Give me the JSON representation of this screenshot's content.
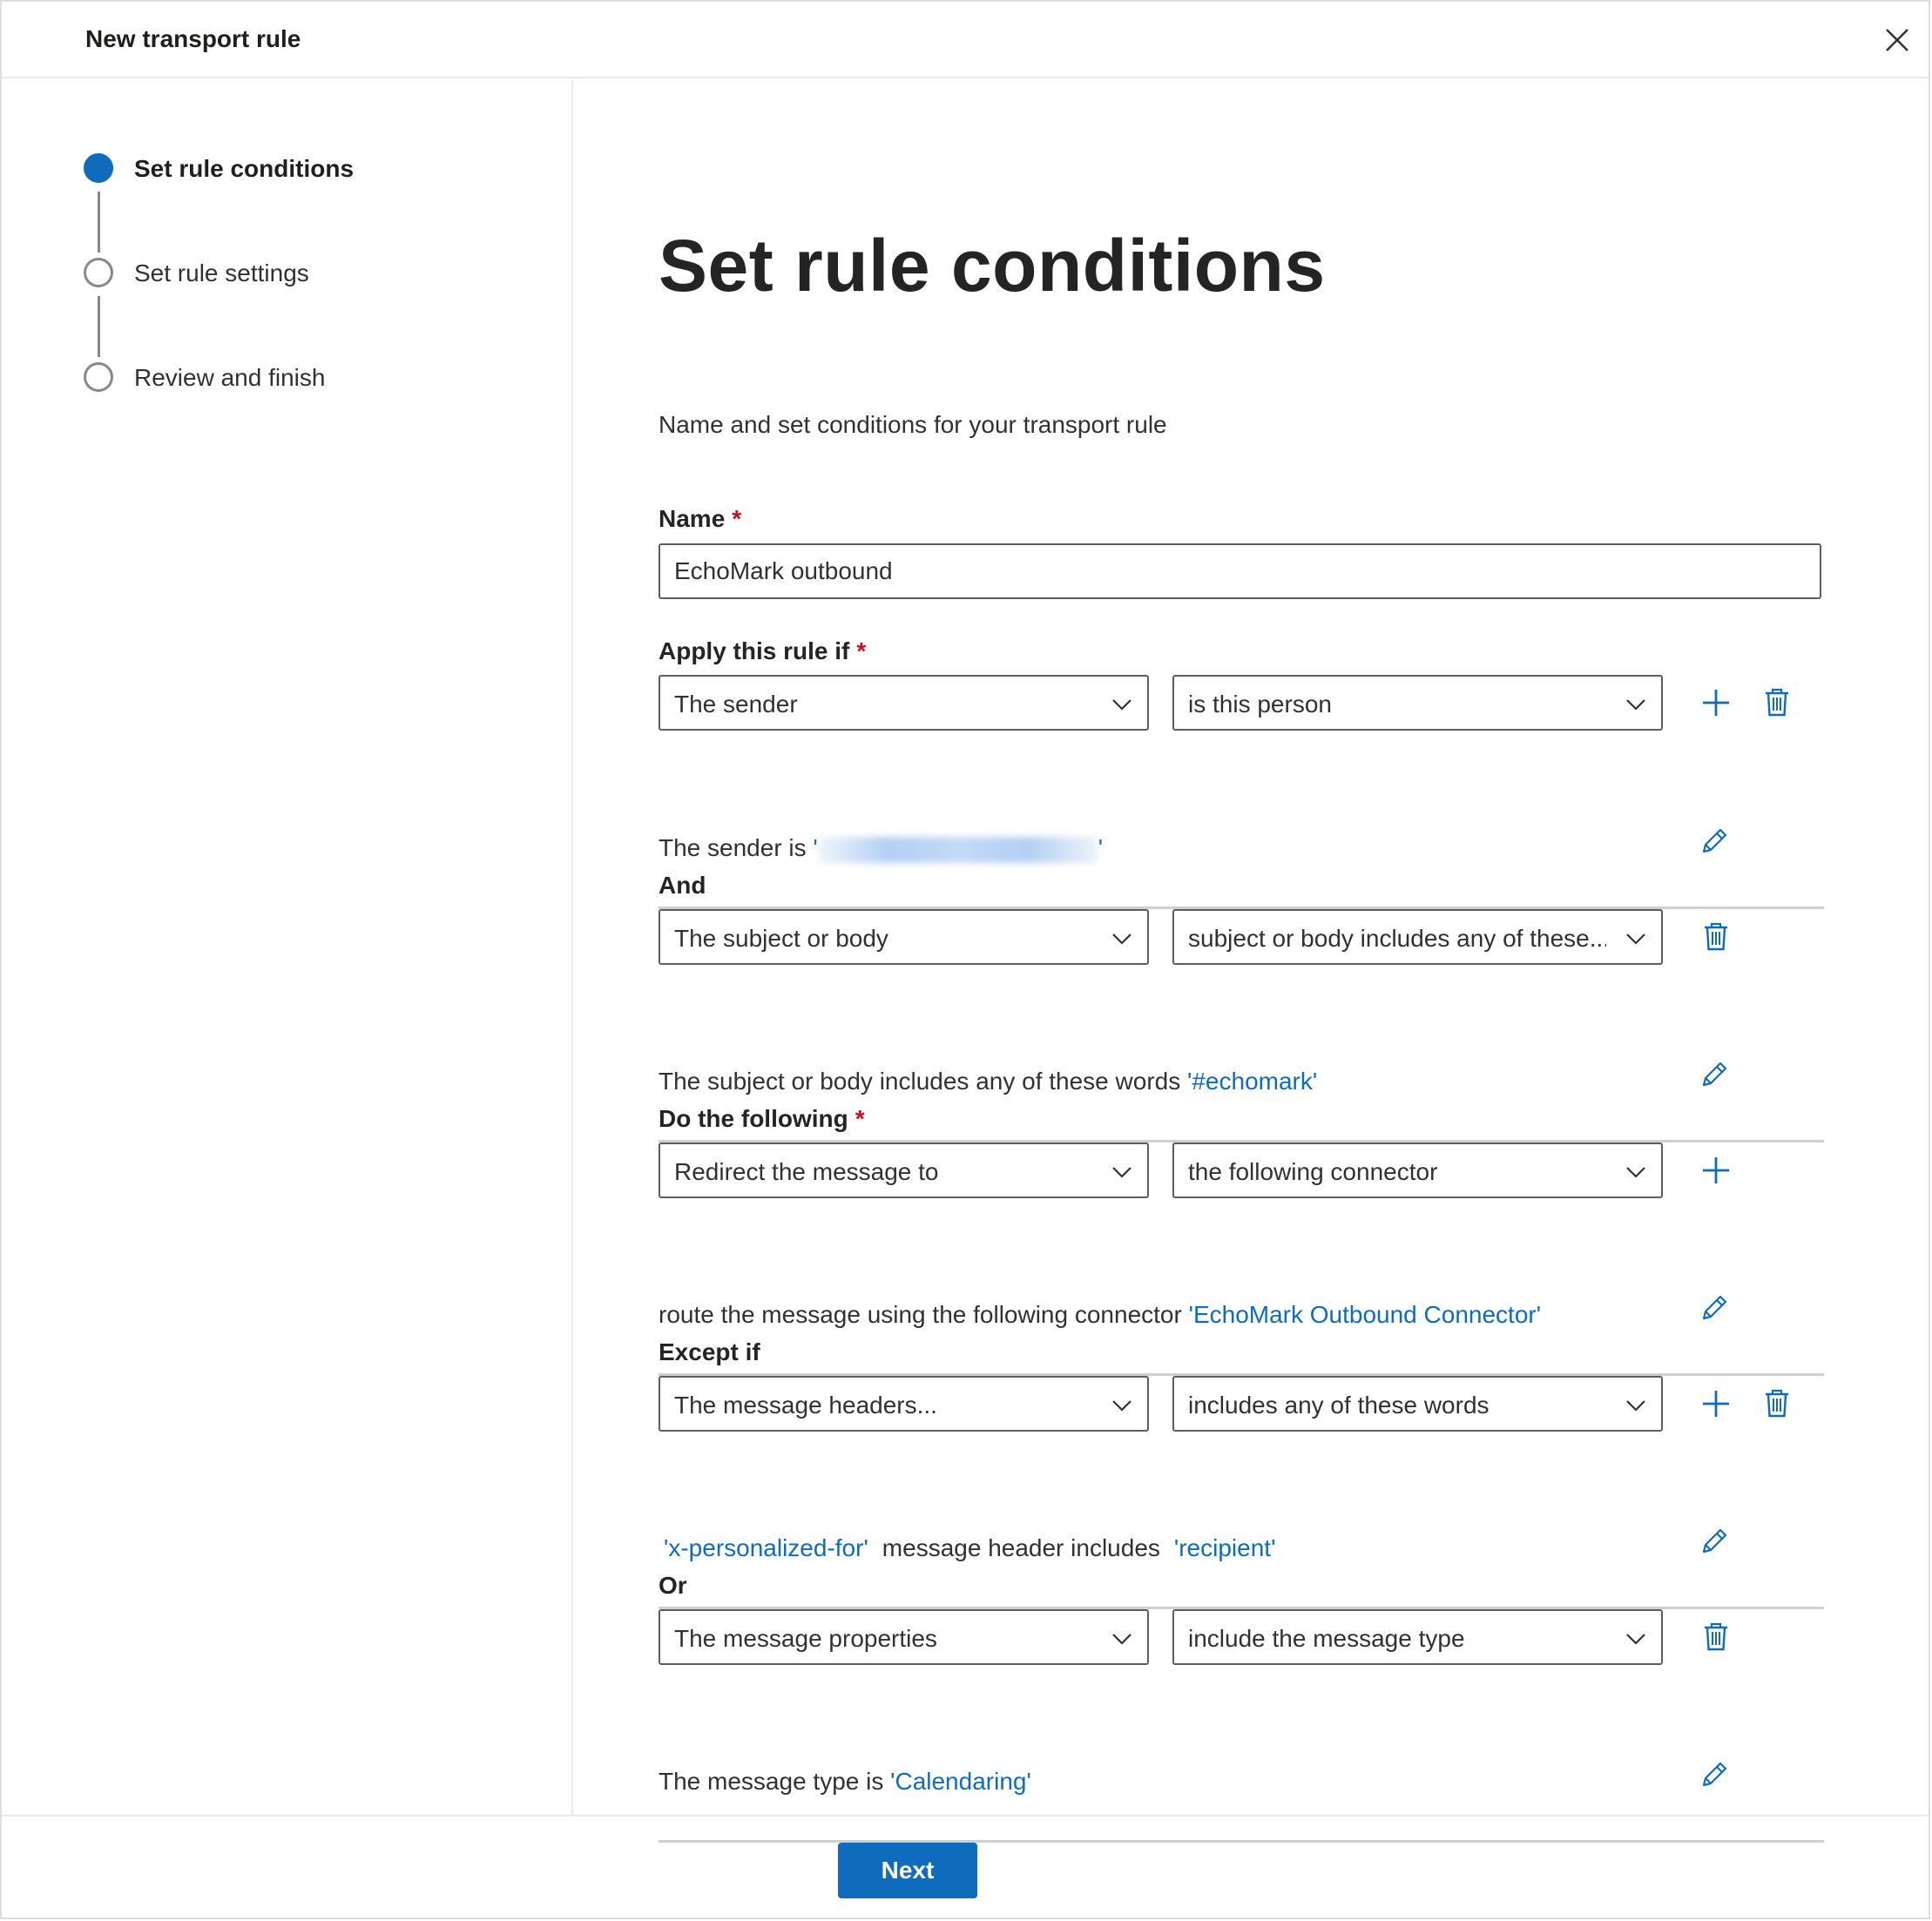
{
  "header": {
    "title": "New transport rule",
    "close_icon": "close-icon"
  },
  "nav": {
    "steps": [
      {
        "label": "Set rule conditions",
        "state": "active"
      },
      {
        "label": "Set rule settings",
        "state": "pending"
      },
      {
        "label": "Review and finish",
        "state": "pending"
      }
    ]
  },
  "main": {
    "title": "Set rule conditions",
    "subtitle": "Name and set conditions for your transport rule",
    "name": {
      "label": "Name",
      "required_mark": "*",
      "value": "EchoMark outbound"
    },
    "sections": [
      {
        "label": "Apply this rule if",
        "required_mark": "*",
        "left": "The sender",
        "right": "is this person",
        "desc_prefix": "The sender is ",
        "desc_link": "'",
        "desc_suffix": "'",
        "has_add": true,
        "has_delete": true
      },
      {
        "label": "And",
        "required_mark": "",
        "left": "The subject or body",
        "right": "subject or body includes any of these...",
        "desc_prefix": "The subject or body includes any of these words ",
        "desc_link": "'#echomark'",
        "has_add": false,
        "has_delete": true
      },
      {
        "label": "Do the following",
        "required_mark": "*",
        "left": "Redirect the message to",
        "right": "the following connector",
        "desc_prefix": "route the message using the following connector ",
        "desc_link": "'EchoMark Outbound Connector'",
        "has_add": true,
        "has_delete": false
      },
      {
        "label": "Except if",
        "required_mark": "",
        "left": "The message headers...",
        "right": "includes any of these words",
        "desc_link_1": "'x-personalized-for'",
        "desc_middle": "message header includes",
        "desc_link_2": "'recipient'",
        "has_add": true,
        "has_delete": true
      },
      {
        "label": "Or",
        "required_mark": "",
        "left": "The message properties",
        "right": "include the message type",
        "desc_prefix": "The message type is ",
        "desc_link": "'Calendaring'",
        "has_add": false,
        "has_delete": true
      }
    ]
  },
  "footer": {
    "next_label": "Next"
  },
  "colors": {
    "accent": "#0f6cbd",
    "required": "#c50f1f",
    "border": "#605e5c",
    "divider": "#d2d0ce"
  }
}
